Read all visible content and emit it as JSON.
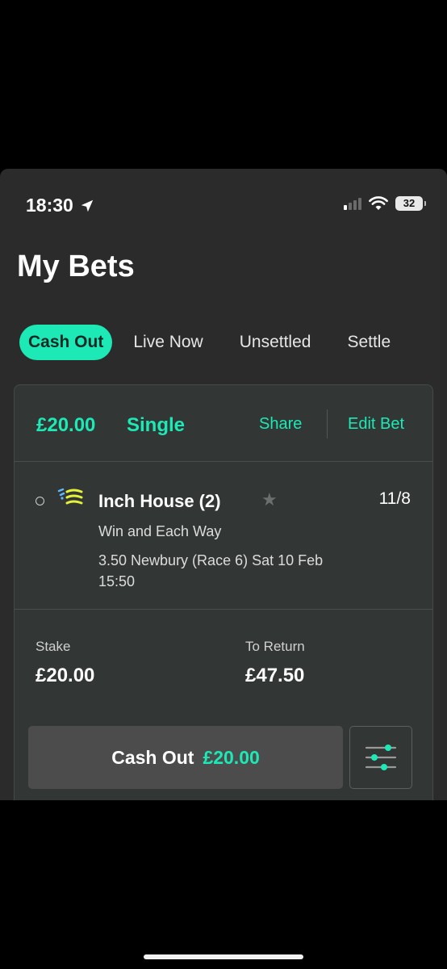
{
  "status_bar": {
    "time": "18:30",
    "battery": "32",
    "icons": [
      "location-arrow-icon",
      "cellular-signal-icon",
      "wifi-icon",
      "battery-icon"
    ]
  },
  "page_title": "My Bets",
  "tabs": [
    {
      "label": "Cash Out",
      "active": true
    },
    {
      "label": "Live Now",
      "active": false
    },
    {
      "label": "Unsettled",
      "active": false
    },
    {
      "label": "Settle",
      "active": false
    }
  ],
  "bet": {
    "amount": "£20.00",
    "type": "Single",
    "share_label": "Share",
    "edit_label": "Edit Bet",
    "selection": {
      "name": "Inch House (2)",
      "odds": "11/8",
      "market": "Win and Each Way",
      "event": "3.50 Newbury (Race 6)   Sat 10 Feb 15:50",
      "silks_icon": "jockey-silks-icon",
      "favourite_icon": "star-icon"
    },
    "stake_label": "Stake",
    "stake_value": "£20.00",
    "return_label": "To Return",
    "return_value": "£47.50",
    "cashout_label": "Cash Out",
    "cashout_amount": "£20.00",
    "settings_icon": "sliders-icon"
  },
  "colors": {
    "accent": "#1de9b6",
    "background": "#2b2b2b",
    "card": "#323634"
  }
}
